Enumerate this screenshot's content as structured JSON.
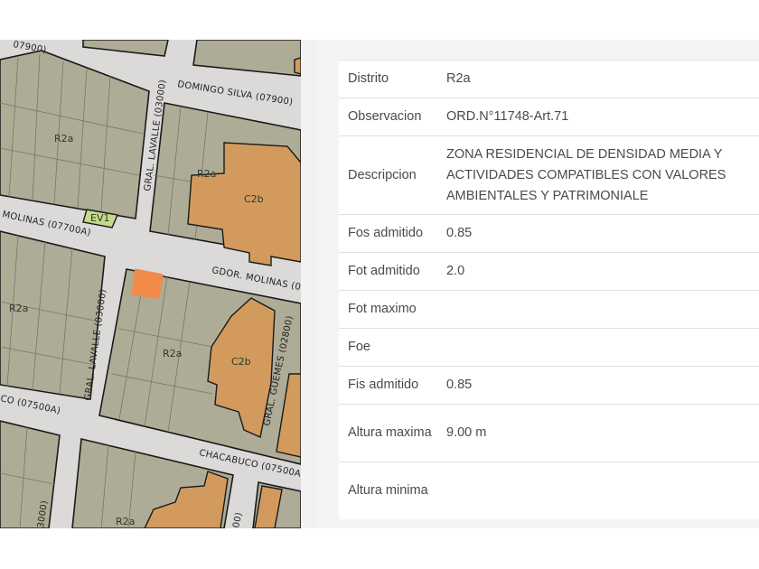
{
  "map": {
    "streets": {
      "domingo_silva": "DOMINGO SILVA (07900)",
      "gral_lavalle_top": "GRAL. LAVALLE (03000)",
      "molinas_left": "MOLINAS (07700A)",
      "gdor_molinas": "GDOR. MOLINAS (0",
      "gral_lavalle_mid": "GRAL. LAVALLE (03000)",
      "gral_guemes": "GRAL. GUEMES (02800)",
      "chacabuco_left": "CO (07500A)",
      "chacabuco_right": "CHACABUCO (07500A",
      "lavalle_bottom": "3000)",
      "top_left_edge": "07900)",
      "bottom_right_edge": "00)"
    },
    "zones": [
      "R2a",
      "R2a",
      "C2b",
      "EV1",
      "R2a",
      "R2a",
      "C2b",
      "R2a",
      "C2"
    ],
    "colors": {
      "residential": "#aeac96",
      "commercial": "#d39a5e",
      "green": "#c4d98a",
      "street": "#dcdad9",
      "selected_parcel": "#f28b4a"
    }
  },
  "attributes": [
    {
      "label": "Distrito",
      "value": "R2a"
    },
    {
      "label": "Observacion",
      "value": "ORD.N°11748-Art.71"
    },
    {
      "label": "Descripcion",
      "value": "ZONA RESIDENCIAL DE DENSIDAD MEDIA Y ACTIVIDADES COMPATIBLES CON VALORES AMBIENTALES Y PATRIMONIALE"
    },
    {
      "label": "Fos admitido",
      "value": "0.85"
    },
    {
      "label": "Fot admitido",
      "value": "2.0"
    },
    {
      "label": "Fot maximo",
      "value": ""
    },
    {
      "label": "Foe",
      "value": ""
    },
    {
      "label": "Fis admitido",
      "value": "0.85"
    },
    {
      "label": "Altura maxima",
      "value": "9.00 m"
    },
    {
      "label": "Altura minima",
      "value": ""
    }
  ]
}
